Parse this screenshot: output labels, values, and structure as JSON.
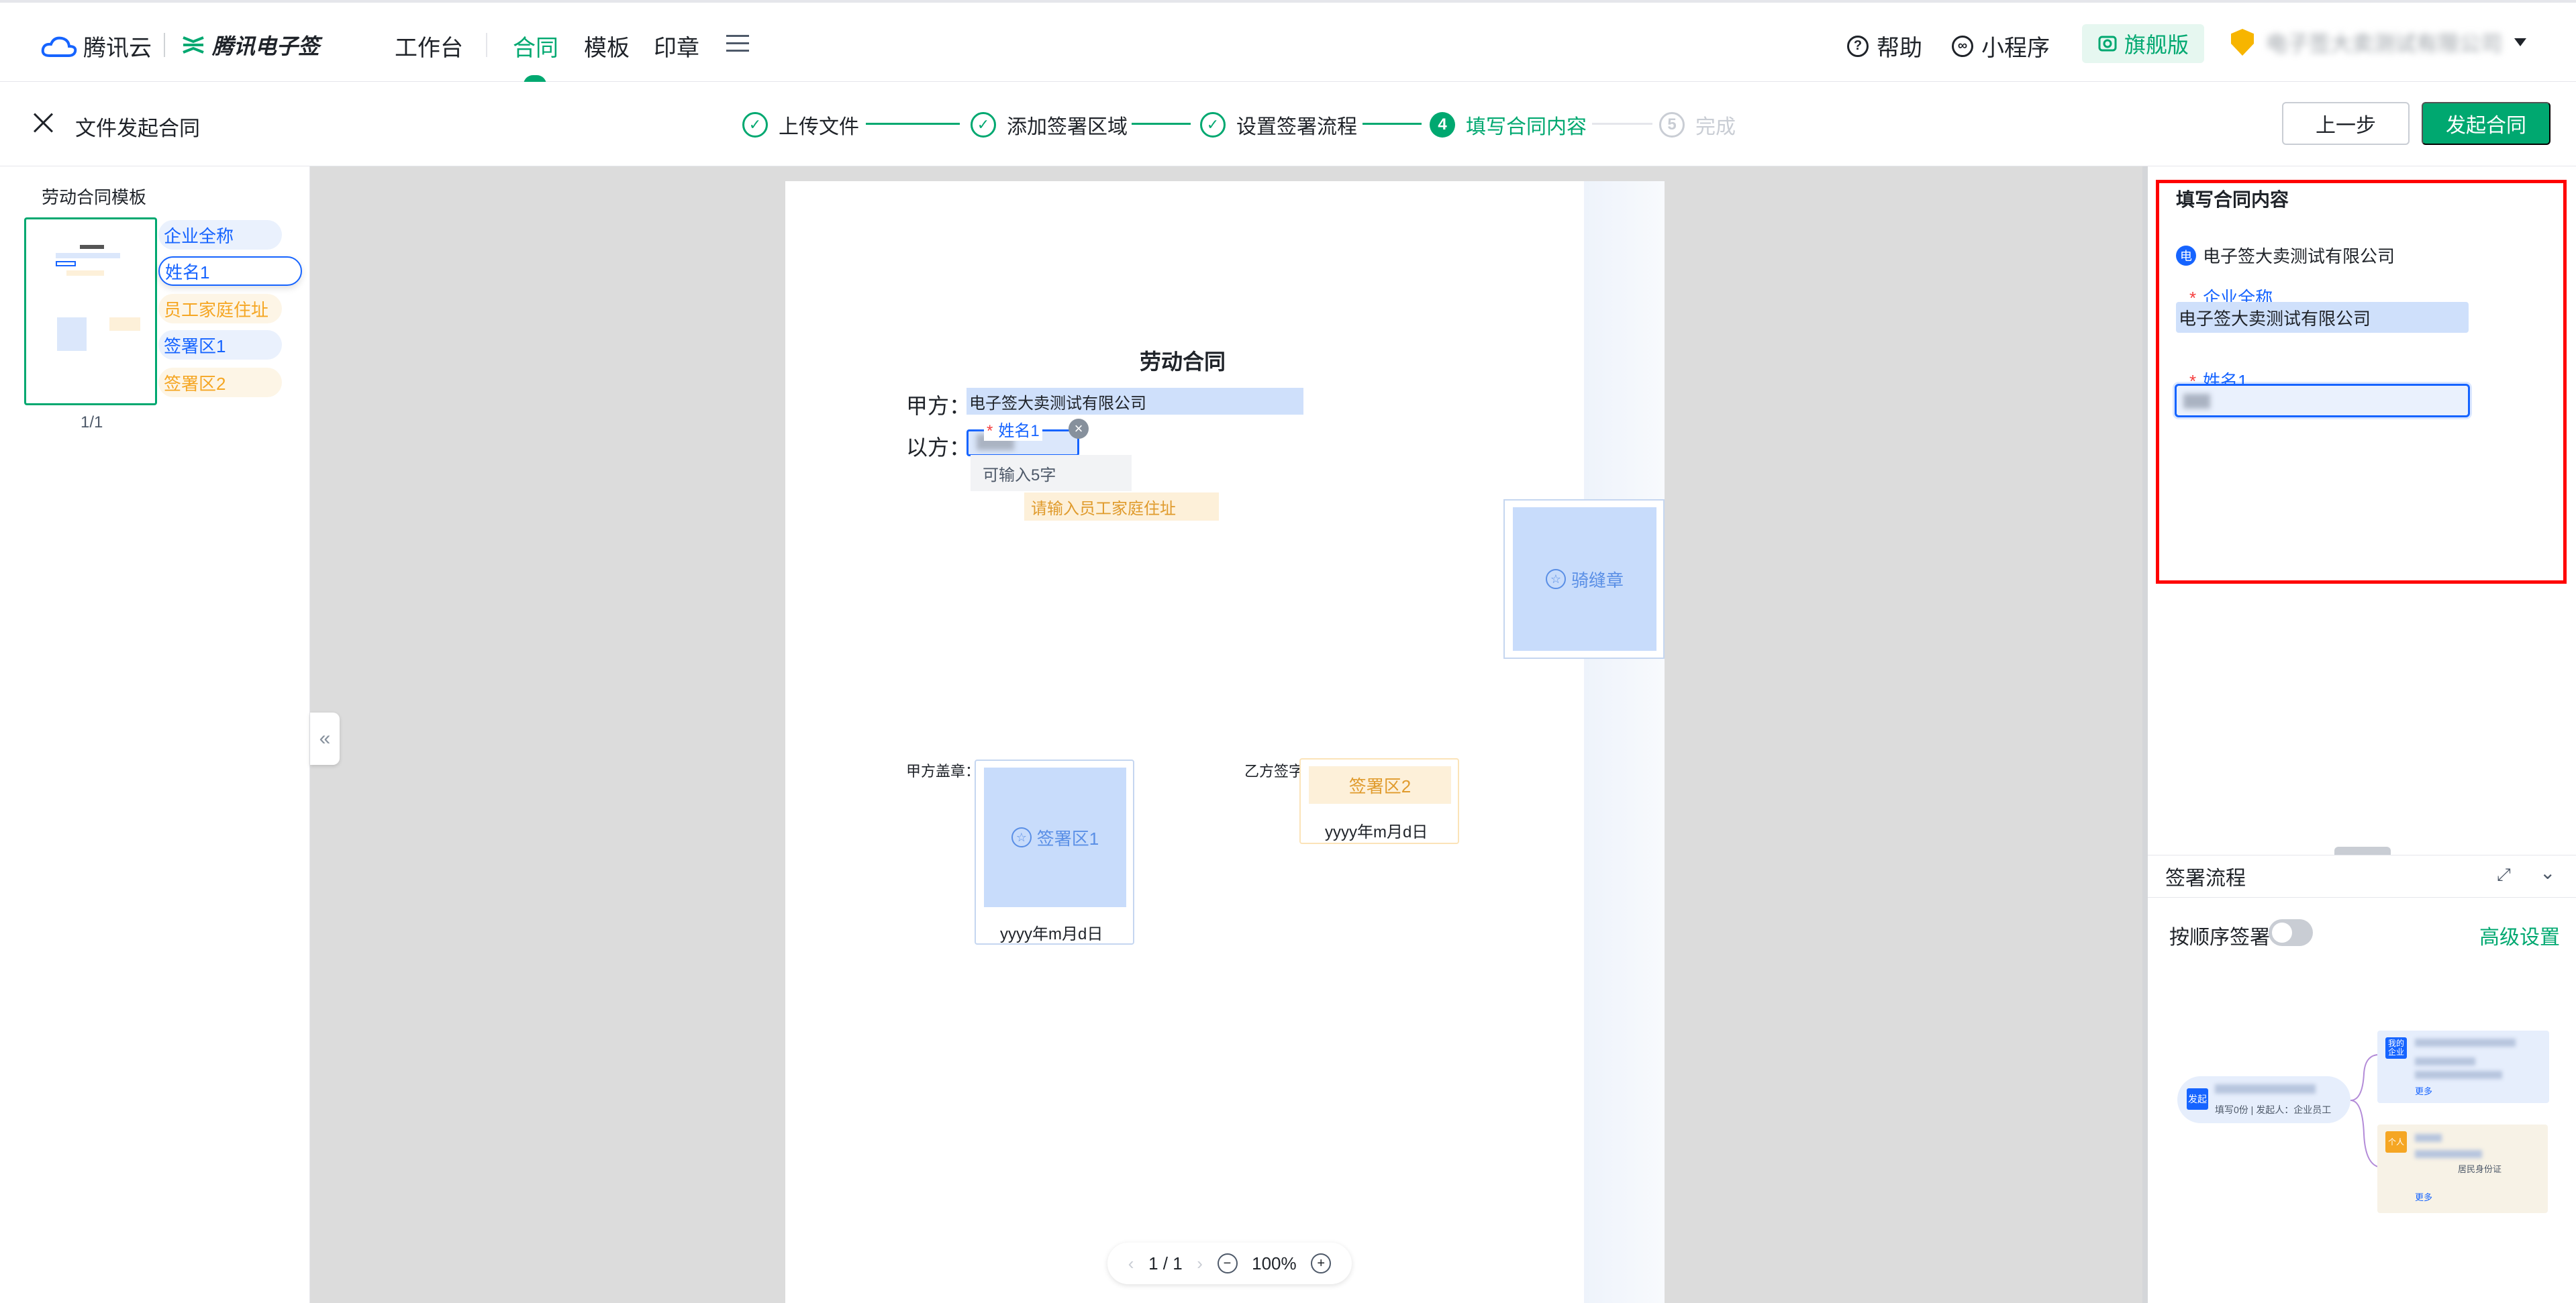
{
  "topnav": {
    "brand_cloud": "腾讯云",
    "brand_esign": "腾讯电子签",
    "items": [
      "工作台",
      "合同",
      "模板",
      "印章"
    ],
    "active_item": "合同",
    "help": "帮助",
    "mini_program": "小程序",
    "flagship": "旗舰版",
    "company": "电子签大卖测试有限公司"
  },
  "stepbar": {
    "heading": "文件发起合同",
    "steps": [
      {
        "label": "上传文件",
        "status": "done"
      },
      {
        "label": "添加签署区域",
        "status": "done"
      },
      {
        "label": "设置签署流程",
        "status": "done"
      },
      {
        "label": "填写合同内容",
        "status": "current",
        "num": "4"
      },
      {
        "label": "完成",
        "status": "pending",
        "num": "5"
      }
    ],
    "prev_btn": "上一步",
    "launch_btn": "发起合同"
  },
  "leftbar": {
    "template_title": "劳动合同模板",
    "page_indicator": "1/1",
    "fields": [
      {
        "label": "企业全称",
        "color": "blue"
      },
      {
        "label": "姓名1",
        "color": "blue",
        "active": true
      },
      {
        "label": "员工家庭住址",
        "color": "orange"
      },
      {
        "label": "签署区1",
        "color": "blue"
      },
      {
        "label": "签署区2",
        "color": "orange"
      }
    ]
  },
  "document": {
    "title": "劳动合同",
    "party_a_label": "甲方：",
    "party_a_value": "电子签大卖测试有限公司",
    "party_b_label": "以方：",
    "name_field_label": "姓名1",
    "tooltip": "可输入5字",
    "address_placeholder": "请输入员工家庭住址",
    "seam_seal": "骑缝章",
    "party_a_seal_label": "甲方盖章：",
    "party_b_sign_label": "乙方签字",
    "sign_area_1": "签署区1",
    "sign_area_2": "签署区2",
    "date_format": "yyyy年m月d日"
  },
  "zoombar": {
    "page": "1 / 1",
    "zoom": "100%"
  },
  "rightpanel": {
    "title": "填写合同内容",
    "company_badge": "电",
    "company": "电子签大卖测试有限公司",
    "field1_label": "企业全称",
    "field1_value": "电子签大卖测试有限公司",
    "field2_label": "姓名1"
  },
  "flow": {
    "title": "签署流程",
    "sequential_label": "按顺序签署",
    "sequential_on": false,
    "advanced": "高级设置",
    "start_node_tag": "发起",
    "start_node_sub": "填写0份 | 发起人：企业员工",
    "card1_tag": "我的企业",
    "card1_more": "更多",
    "card2_tag": "个人",
    "card2_id_type": "居民身份证",
    "card2_more": "更多"
  },
  "colors": {
    "accent": "#00a870",
    "field_blue": "#1664ff",
    "field_orange": "#f5a623",
    "highlight": "#ff0000"
  }
}
